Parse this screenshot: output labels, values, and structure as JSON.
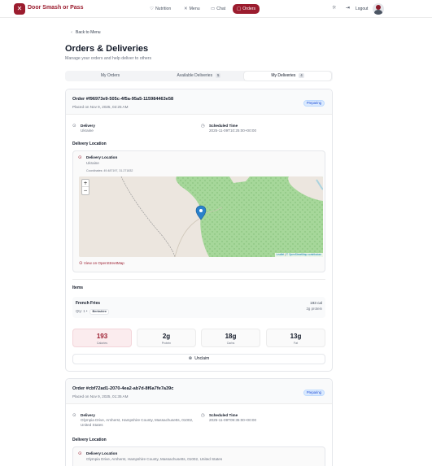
{
  "app": {
    "brand": "Door Smash or Pass",
    "logo_glyph": "✕"
  },
  "nav": {
    "items": [
      {
        "label": "Nutrition",
        "icon": "heart-icon"
      },
      {
        "label": "Menu",
        "icon": "utensils-icon"
      },
      {
        "label": "Chat",
        "icon": "chat-icon"
      },
      {
        "label": "Orders",
        "icon": "bag-icon",
        "active": true
      }
    ],
    "theme_icon": "sun-icon",
    "logout_label": "Logout"
  },
  "page": {
    "back_label": "Back to Menu",
    "title": "Orders & Deliveries",
    "subtitle": "Manage your orders and help deliver to others"
  },
  "tabs": [
    {
      "label": "My Orders",
      "badge": ""
    },
    {
      "label": "Available Deliveries",
      "badge": "5"
    },
    {
      "label": "My Deliveries",
      "badge": "4"
    }
  ],
  "orders": [
    {
      "id": "Order #f96973e9-505c-4f5a-95a5-115984463e58",
      "placed": "Placed on Nov 9, 2025, 02:25 AM",
      "status": "Preparing",
      "delivery_label": "Delivery",
      "delivery_value": "Ukraine",
      "scheduled_label": "Scheduled Time",
      "scheduled_value": "2025-11-09T10:25:00+00:00",
      "location_section": "Delivery Location",
      "location_label": "Delivery Location",
      "location_value": "Ukraine",
      "coordinates": "Coordinates: 49.487197, 31.271832",
      "map_attribution_leaflet": "Leaflet",
      "map_attribution_osm": "© OpenStreetMap contributors",
      "osm_link": "View on OpenStreetMap",
      "items_section": "Items",
      "items": [
        {
          "name": "French Fries",
          "qty": "Qty: 1 •",
          "tag": "Berkshire",
          "calories": "193 cal",
          "protein": "2g protein"
        }
      ],
      "totals": [
        {
          "value": "193",
          "label": "Calories"
        },
        {
          "value": "2g",
          "label": "Protein"
        },
        {
          "value": "18g",
          "label": "Carbs"
        },
        {
          "value": "13g",
          "label": "Fat"
        }
      ],
      "unclaim_label": "Unclaim"
    },
    {
      "id": "Order #cbf72ad1-2070-4ea2-ab7d-8f6a7fe7a39c",
      "placed": "Placed on Nov 9, 2025, 01:35 AM",
      "status": "Preparing",
      "delivery_label": "Delivery",
      "delivery_value": "Olympia Drive, Amherst, Hampshire County, Massachusetts, 01002, United States",
      "scheduled_label": "Scheduled Time",
      "scheduled_value": "2025-11-09T09:35:00+00:00",
      "location_section": "Delivery Location",
      "location_label": "Delivery Location",
      "location_value": "Olympia Drive, Amherst, Hampshire County, Massachusetts, 01002, United States"
    }
  ],
  "colors": {
    "brand": "#9b1c2e",
    "status_bg": "#dbeafe",
    "status_text": "#1d4ed8",
    "map_forest": "#8ec98a",
    "map_land": "#ece6df"
  }
}
